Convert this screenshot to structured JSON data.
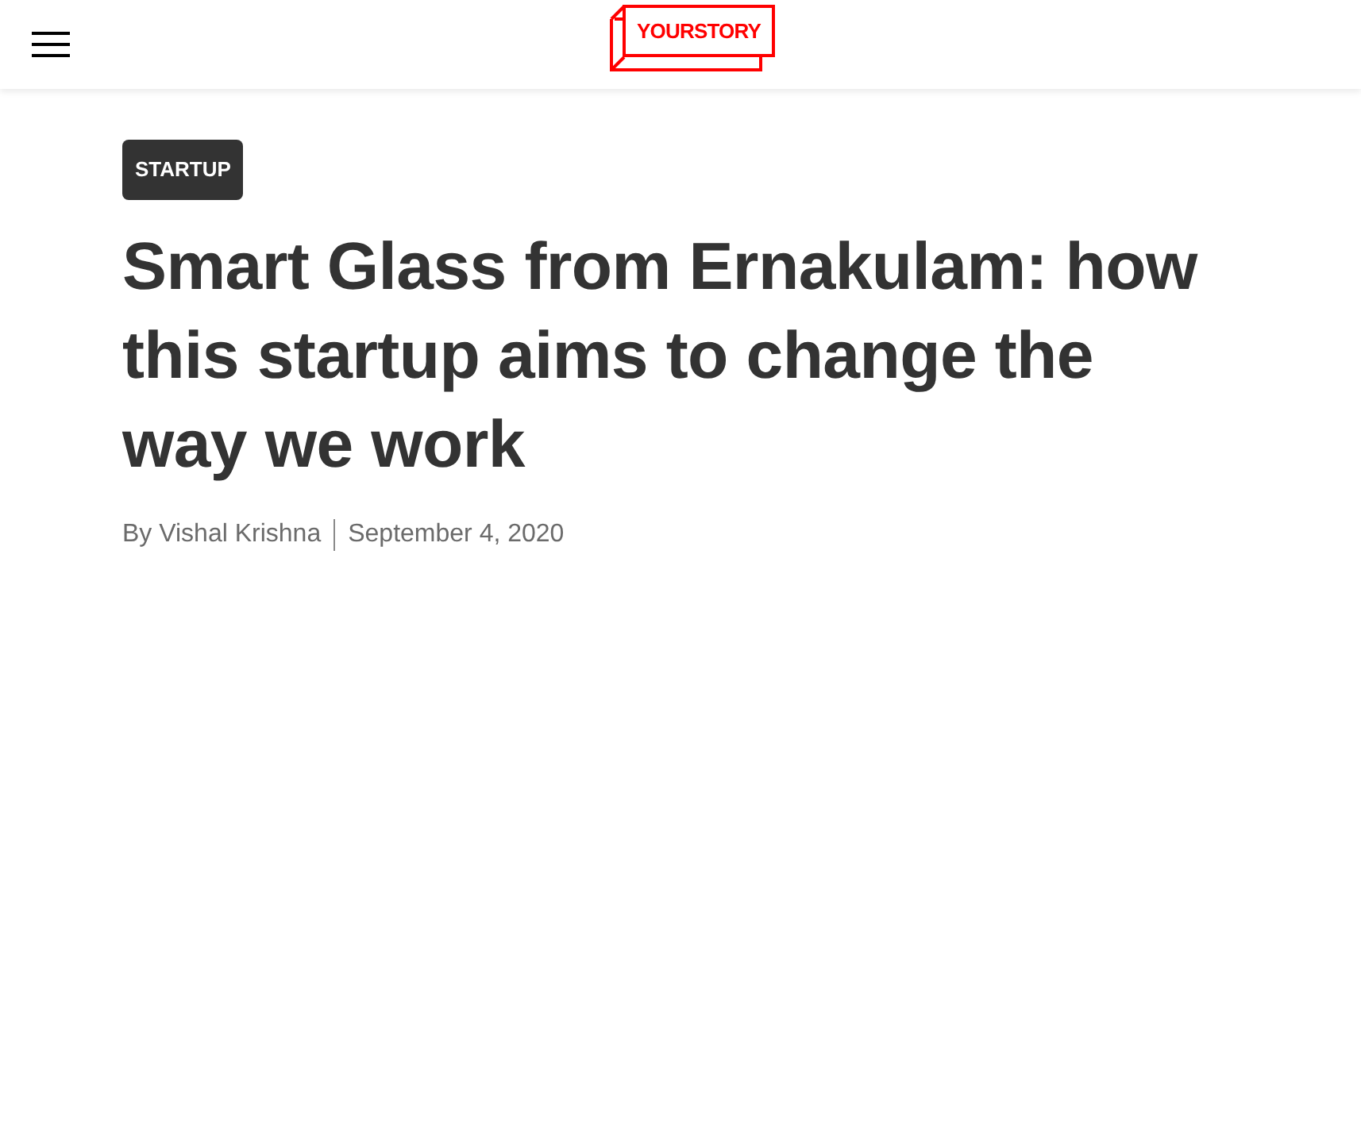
{
  "header": {
    "logo_text": "YOURSTORY"
  },
  "article": {
    "category": "STARTUP",
    "title": "Smart Glass from Ernakulam: how this startup aims to change the way we work",
    "author": "By Vishal Krishna",
    "date": "September 4, 2020"
  }
}
